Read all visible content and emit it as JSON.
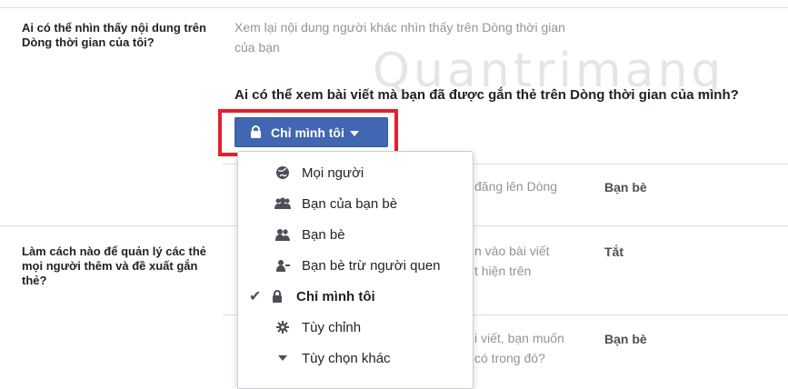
{
  "sections": [
    {
      "label": "Ai có thể nhìn thấy nội dung trên Dòng thời gian của tôi?",
      "sub": "Xem lại nội dung người khác nhìn thấy trên Dòng thời gian của bạn"
    },
    {
      "label": "Làm cách nào để quản lý các thẻ mọi người thêm và đề xuất gắn thẻ?"
    }
  ],
  "question": "Ai có thể xem bài viết mà bạn đã được gắn thẻ trên Dòng thời gian của mình?",
  "privacy_button": {
    "label": "Chỉ mình tôi"
  },
  "behind_text": {
    "row1": "đăng lên Dòng",
    "row2a": "n vào bài viết",
    "row2b": "t hiện trên",
    "row3a": "i viết, bạn muốn",
    "row3b": "có trong đó?"
  },
  "values": {
    "row1": "Bạn bè",
    "row2": "Tắt",
    "row3": "Bạn bè"
  },
  "menu": {
    "items": [
      {
        "label": "Mọi người",
        "icon": "globe-icon"
      },
      {
        "label": "Bạn của bạn bè",
        "icon": "friends-of-friends-icon"
      },
      {
        "label": "Bạn bè",
        "icon": "friends-icon"
      },
      {
        "label": "Bạn bè trừ người quen",
        "icon": "friends-except-icon"
      },
      {
        "label": "Chỉ mình tôi",
        "icon": "lock-icon",
        "selected": true
      },
      {
        "label": "Tùy chỉnh",
        "icon": "gear-icon"
      },
      {
        "label": "Tùy chọn khác",
        "icon": "caret-down-icon"
      }
    ]
  },
  "colors": {
    "button": "#4267b2",
    "highlight": "#e5202b",
    "text_muted": "#90949c"
  },
  "watermark": "Quantrimang"
}
